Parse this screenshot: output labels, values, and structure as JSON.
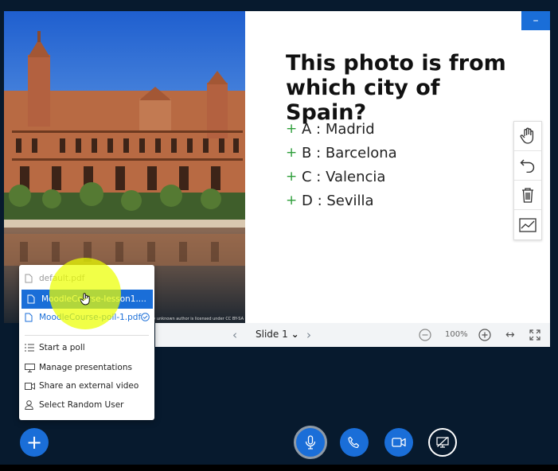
{
  "slide": {
    "question": "This photo is from which city of Spain?",
    "answers": [
      {
        "marker": "+",
        "text": "A  : Madrid"
      },
      {
        "marker": "+",
        "text": "B  : Barcelona"
      },
      {
        "marker": "+",
        "text": "C  : Valencia"
      },
      {
        "marker": "+",
        "text": "D  : Sevilla"
      }
    ],
    "minimize_label": "–",
    "photo_credit": "by unknown author is licensed under CC BY-SA"
  },
  "navbar": {
    "prev": "‹",
    "slide_label": "Slide 1",
    "chevron": "⌄",
    "next": "›",
    "zoom": "100%",
    "fit_width": "↔"
  },
  "menu": {
    "presentations": [
      {
        "label": "default.pdf",
        "state": "inactive"
      },
      {
        "label": "MoodleCourse-lesson1....",
        "state": "hovered"
      },
      {
        "label": "MoodleCourse-poll-1.pdf",
        "state": "current"
      }
    ],
    "actions": [
      {
        "label": "Start a poll",
        "icon": "poll-list-icon"
      },
      {
        "label": "Manage presentations",
        "icon": "presentation-icon"
      },
      {
        "label": "Share an external video",
        "icon": "video-icon"
      },
      {
        "label": "Select Random User",
        "icon": "user-icon"
      }
    ]
  },
  "controls": {
    "plus": "+",
    "accent": "#1a6ed8"
  }
}
